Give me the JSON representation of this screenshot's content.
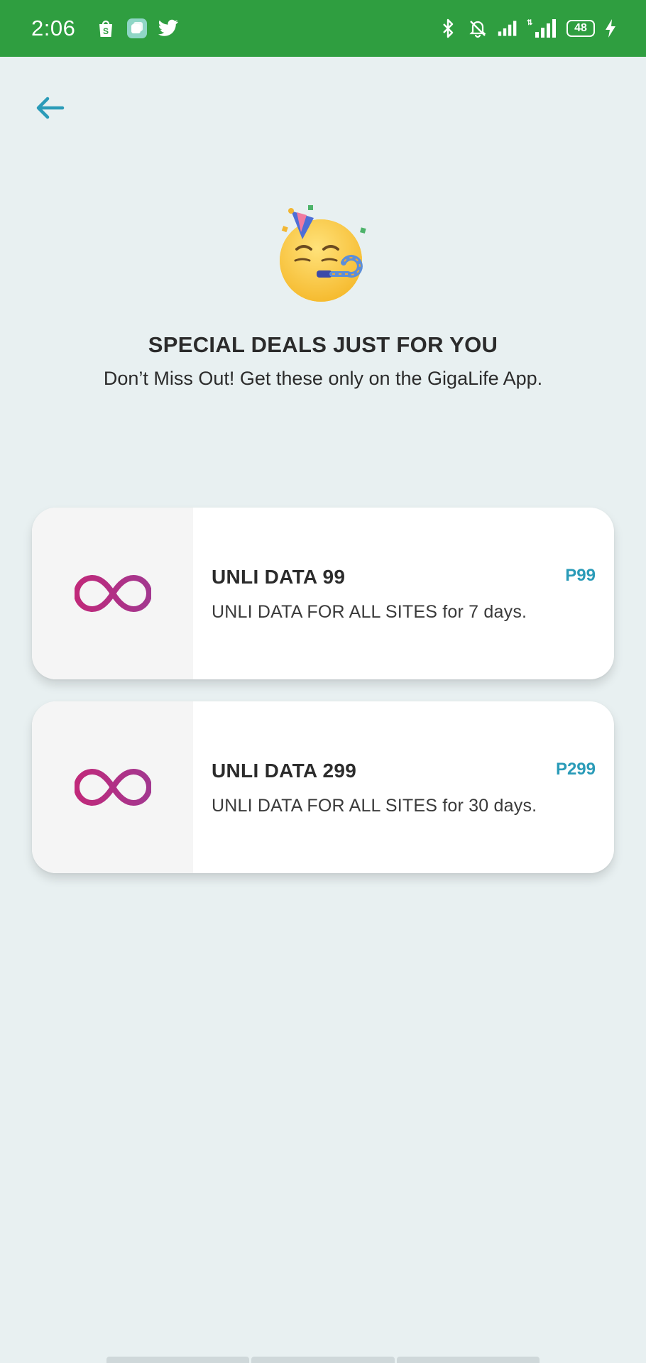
{
  "status_bar": {
    "time": "2:06",
    "network_label": "4G",
    "battery_level": "48",
    "left_icons": [
      "shopee-icon",
      "app-icon",
      "twitter-icon"
    ],
    "right_icons": [
      "bluetooth-icon",
      "mute-bell-icon",
      "signal-icon",
      "4g-signal-icon",
      "battery-icon",
      "charging-icon"
    ],
    "color": "#2f9e40"
  },
  "header": {
    "back_icon": "arrow-left-icon",
    "accent_color": "#2a9bb8"
  },
  "hero": {
    "icon": "party-face-emoji",
    "title": "SPECIAL DEALS JUST FOR YOU",
    "subtitle": "Don’t Miss Out! Get these only on the GigaLife App."
  },
  "offers": [
    {
      "icon": "infinity-icon",
      "title": "UNLI DATA 99",
      "description": "UNLI DATA FOR ALL SITES for 7 days.",
      "price": "P99"
    },
    {
      "icon": "infinity-icon",
      "title": "UNLI DATA 299",
      "description": "UNLI DATA FOR ALL SITES for 30 days.",
      "price": "P299"
    }
  ],
  "colors": {
    "background": "#e8f0f1",
    "price": "#2a9bb8",
    "infinity_gradient": [
      "#c0297a",
      "#a3378f"
    ]
  }
}
